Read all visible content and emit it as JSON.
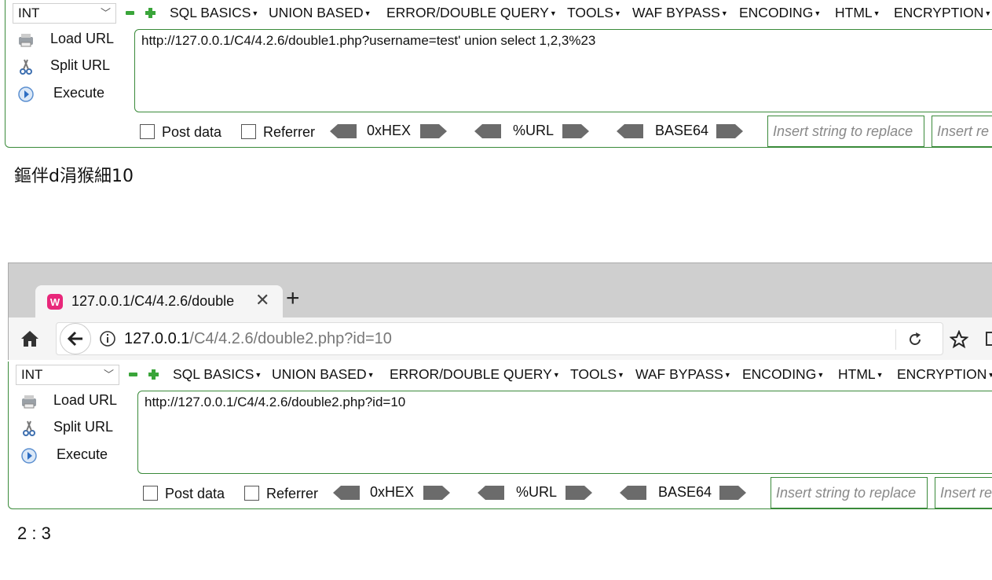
{
  "hackbar_top": {
    "select_value": "INT",
    "menus": [
      "SQL BASICS",
      "UNION BASED",
      "ERROR/DOUBLE QUERY",
      "TOOLS",
      "WAF BYPASS",
      "ENCODING",
      "HTML",
      "ENCRYPTION"
    ],
    "side": {
      "load": "Load URL",
      "split": "Split URL",
      "execute": "Execute"
    },
    "url": "http://127.0.0.1/C4/4.2.6/double1.php?username=test' union select 1,2,3%23",
    "post_data": "Post data",
    "referrer": "Referrer",
    "hex": "0xHEX",
    "urlenc": "%URL",
    "base64": "BASE64",
    "replace_placeholder": "Insert string to replace",
    "replace2_placeholder": "Insert re"
  },
  "page_output_top": "鏂伴d涓猴細10",
  "browser": {
    "tab_title": "127.0.0.1/C4/4.2.6/double",
    "new_tab": "+",
    "address_host": "127.0.0.1",
    "address_path": "/C4/4.2.6/double2.php?id=10"
  },
  "hackbar_bottom": {
    "select_value": "INT",
    "menus": [
      "SQL BASICS",
      "UNION BASED",
      "ERROR/DOUBLE QUERY",
      "TOOLS",
      "WAF BYPASS",
      "ENCODING",
      "HTML",
      "ENCRYPTION"
    ],
    "side": {
      "load": "Load URL",
      "split": "Split URL",
      "execute": "Execute"
    },
    "url": "http://127.0.0.1/C4/4.2.6/double2.php?id=10",
    "post_data": "Post data",
    "referrer": "Referrer",
    "hex": "0xHEX",
    "urlenc": "%URL",
    "base64": "BASE64",
    "replace_placeholder": "Insert string to replace",
    "replace2_placeholder": "Insert re"
  },
  "page_output_bottom": "2 : 3",
  "colors": {
    "accent_green": "#3a8a3a",
    "icon_green": "#3aa53a",
    "tab_icon": "#e8277a"
  }
}
